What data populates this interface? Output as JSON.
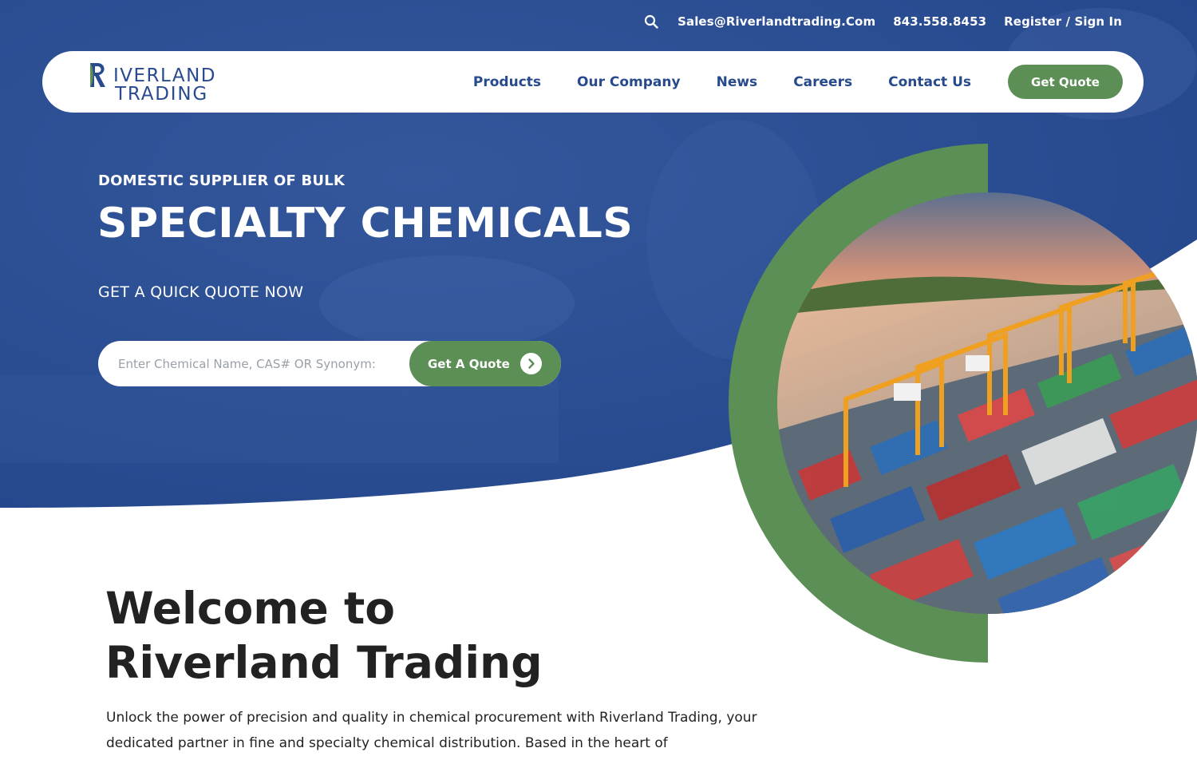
{
  "topbar": {
    "email": "Sales@Riverlandtrading.Com",
    "phone": "843.558.8453",
    "account": "Register / Sign In"
  },
  "logo": {
    "line1": "IVERLAND",
    "line2": "TRADING"
  },
  "nav": {
    "items": [
      {
        "label": "Products"
      },
      {
        "label": "Our Company"
      },
      {
        "label": "News"
      },
      {
        "label": "Careers"
      },
      {
        "label": "Contact Us"
      }
    ],
    "cta_label": "Get Quote"
  },
  "hero": {
    "kicker": "DOMESTIC SUPPLIER OF BULK",
    "headline": "SPECIALTY CHEMICALS",
    "subhead": "GET A QUICK QUOTE NOW",
    "search_placeholder": "Enter Chemical Name, CAS# OR Synonym:",
    "search_button": "Get A Quote"
  },
  "welcome": {
    "title_line1": "Welcome to",
    "title_line2": "Riverland Trading",
    "body": "Unlock the power of precision and quality in chemical procurement with Riverland Trading, your dedicated partner in fine and specialty chemical distribution. Based in the heart of"
  },
  "colors": {
    "brand_blue": "#2b4f95",
    "brand_green": "#5b8f56",
    "nav_text": "#274a8c"
  },
  "icons": {
    "search": "search-icon",
    "arrow": "chevron-right-icon"
  }
}
